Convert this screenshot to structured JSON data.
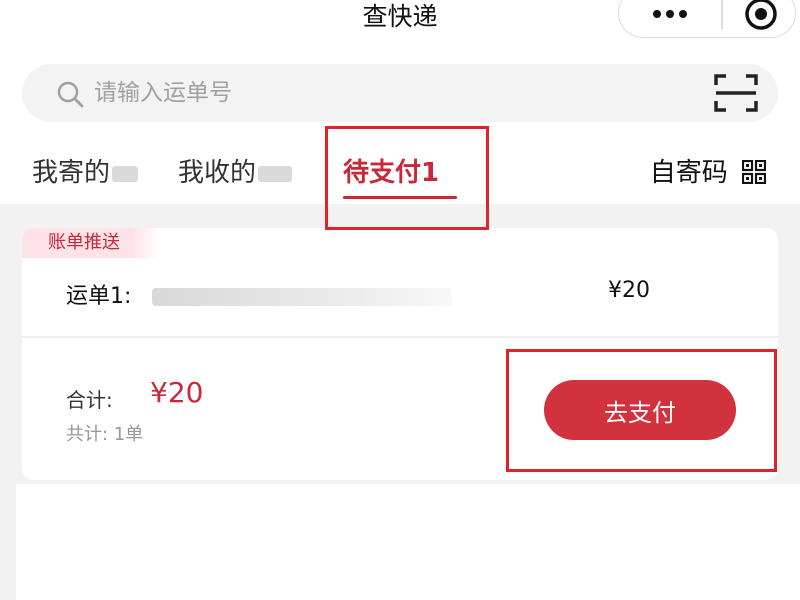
{
  "header": {
    "title": "查快递"
  },
  "capsule": {
    "more_icon": "ellipsis-icon",
    "close_icon": "target-icon"
  },
  "search": {
    "placeholder": "请输入运单号",
    "value": "",
    "search_icon": "search-icon",
    "scan_icon": "scan-icon"
  },
  "tabs": [
    {
      "label": "我寄的",
      "active": false
    },
    {
      "label": "我收的",
      "active": false
    },
    {
      "label": "待支付1",
      "active": true
    }
  ],
  "self_send": {
    "label": "自寄码",
    "icon": "qr-code-icon"
  },
  "bill": {
    "tag": "账单推送",
    "waybill_label": "运单1:",
    "waybill_amount": "¥20",
    "total_label": "合计:",
    "total_amount": "¥20",
    "count_text": "共计: 1单",
    "pay_button": "去支付"
  },
  "colors": {
    "accent": "#c8283a",
    "button": "#d2323d",
    "highlight": "#e0222c",
    "background": "#f2f2f2"
  }
}
